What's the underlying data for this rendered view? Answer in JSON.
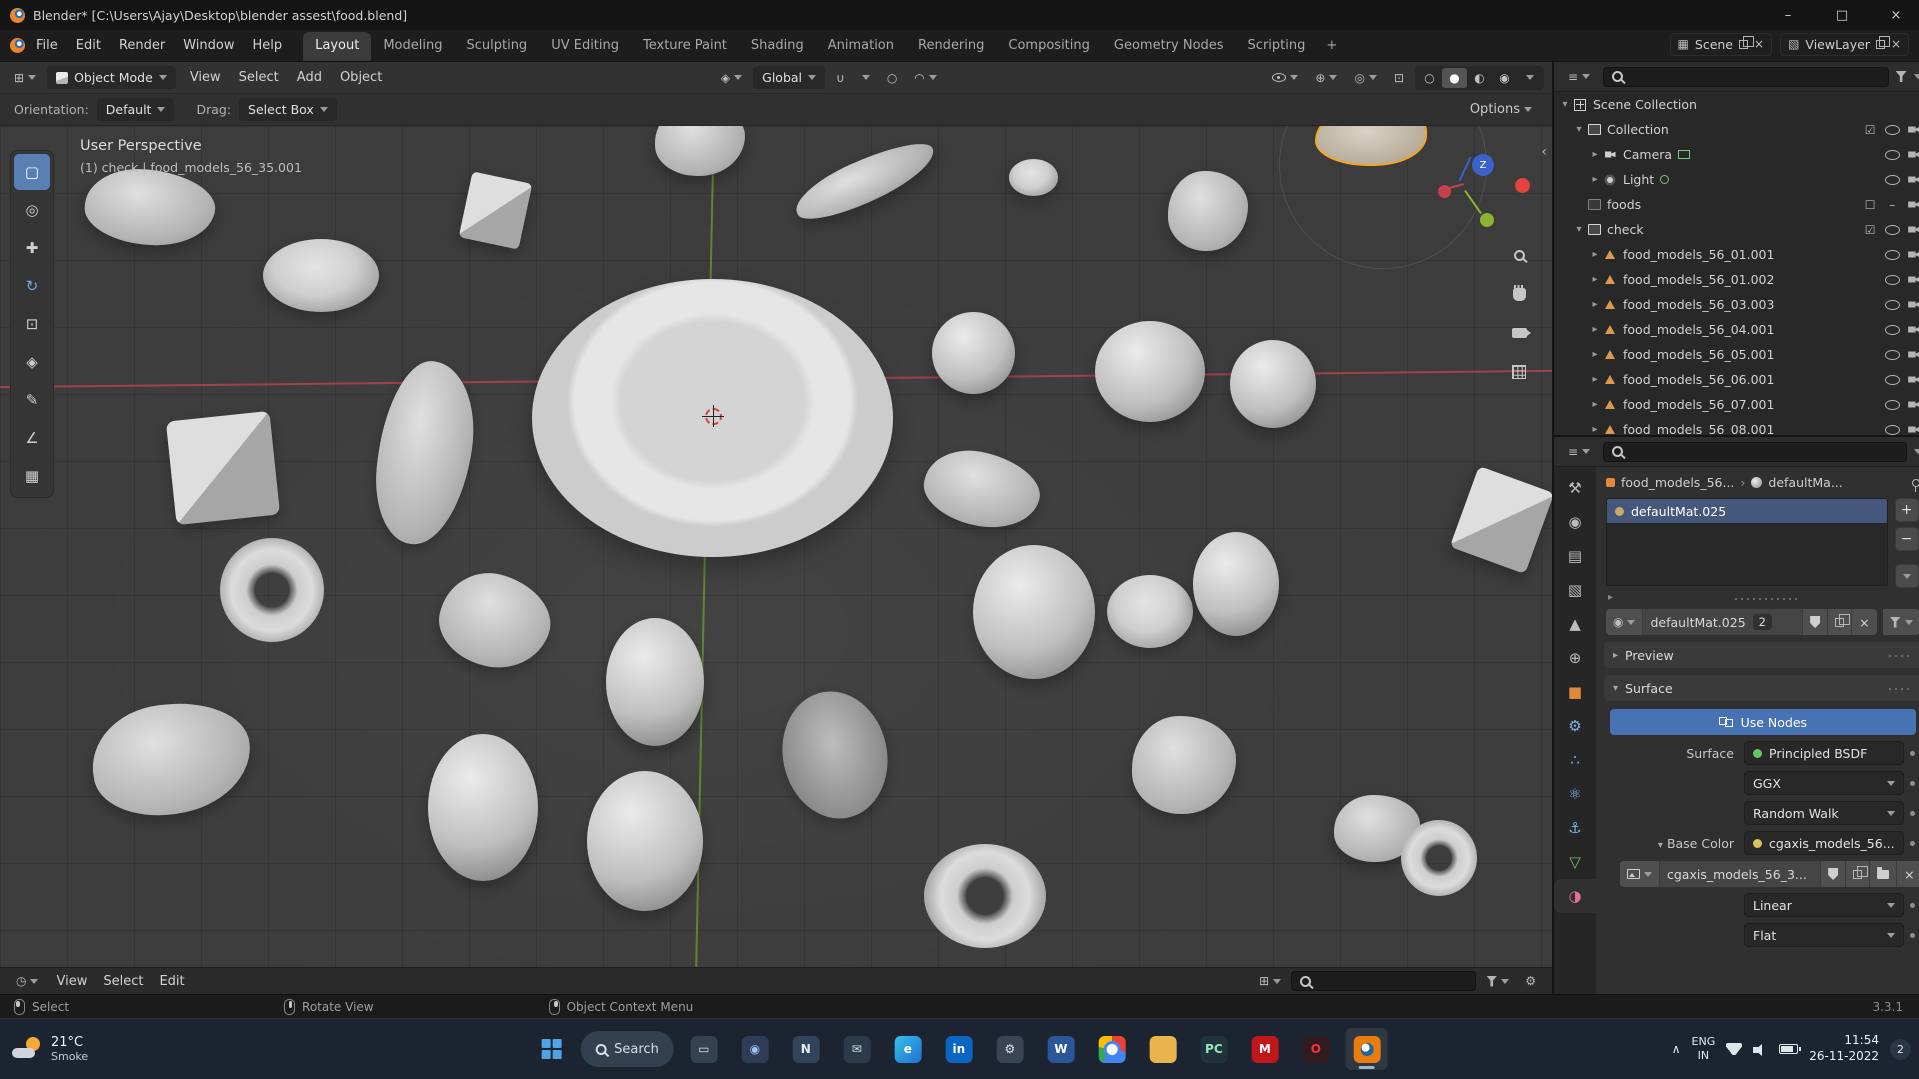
{
  "colors": {
    "accent": "#4772b3",
    "selection": "#f5a623",
    "mesh_icon": "#d99a4e"
  },
  "window": {
    "title": "Blender* [C:\\Users\\Ajay\\Desktop\\blender assest\\food.blend]",
    "minimize": "–",
    "maximize": "□",
    "close": "×"
  },
  "topbar": {
    "menus": [
      "File",
      "Edit",
      "Render",
      "Window",
      "Help"
    ],
    "workspaces": [
      {
        "label": "Layout",
        "active": true
      },
      {
        "label": "Modeling"
      },
      {
        "label": "Sculpting"
      },
      {
        "label": "UV Editing"
      },
      {
        "label": "Texture Paint"
      },
      {
        "label": "Shading"
      },
      {
        "label": "Animation"
      },
      {
        "label": "Rendering"
      },
      {
        "label": "Compositing"
      },
      {
        "label": "Geometry Nodes"
      },
      {
        "label": "Scripting"
      }
    ],
    "add_workspace": "+",
    "scene": {
      "label": "Scene"
    },
    "viewlayer": {
      "label": "ViewLayer"
    }
  },
  "viewport": {
    "header": {
      "mode": "Object Mode",
      "menus": [
        "View",
        "Select",
        "Add",
        "Object"
      ],
      "orientation": "Global",
      "options": "Options"
    },
    "subheader": {
      "orientation_label": "Orientation:",
      "orientation_value": "Default",
      "drag_label": "Drag:",
      "drag_value": "Select Box"
    },
    "overlay": {
      "line1": "User Perspective",
      "line2": "(1) check | food_models_56_35.001"
    },
    "gizmo": {
      "z": "Z"
    },
    "sidebar_toggle": "‹",
    "objects": [
      {
        "name": "plate",
        "kind": "plate",
        "style": "left:532px;top:153px;width:361px;height:278px"
      },
      {
        "name": "small-plate",
        "kind": "disc",
        "style": "left:263px;top:113px;width:116px;height:73px"
      },
      {
        "name": "butter-block",
        "kind": "cube",
        "style": "left:465px;top:51px;width:61px;height:67px;transform:rotate(12deg)"
      },
      {
        "name": "bread-loaf",
        "kind": "blob",
        "style": "left:85px;top:44px;width:130px;height:75px;transform:rotate(6deg)"
      },
      {
        "name": "pastry",
        "kind": "blob",
        "style": "left:655px;top:-22px;width:90px;height:72px"
      },
      {
        "name": "banana",
        "kind": "blob",
        "style": "left:790px;top:34px;width:150px;height:42px;transform:rotate(-24deg)"
      },
      {
        "name": "small-disc",
        "kind": "disc",
        "style": "left:1009px;top:33px;width:49px;height:37px"
      },
      {
        "name": "rock",
        "kind": "blob",
        "style": "left:1168px;top:45px;width:80px;height:80px"
      },
      {
        "name": "selected-sandwich",
        "kind": "selected",
        "style": "left:1315px;top:-18px;width:112px;height:58px"
      },
      {
        "name": "ball",
        "kind": "ball",
        "style": "left:932px;top:186px;width:83px;height:82px"
      },
      {
        "name": "ball",
        "kind": "ball",
        "style": "left:1095px;top:195px;width:110px;height:101px"
      },
      {
        "name": "ball",
        "kind": "ball",
        "style": "left:1230px;top:214px;width:86px;height:88px"
      },
      {
        "name": "cake-slice",
        "kind": "cube",
        "style": "left:171px;top:290px;width:104px;height:104px;transform:rotate(-6deg)"
      },
      {
        "name": "banana-bunch",
        "kind": "blob",
        "style": "left:379px;top:235px;width:92px;height:184px;transform:rotate(8deg)"
      },
      {
        "name": "shell-slices",
        "kind": "blob",
        "style": "left:924px;top:327px;width:116px;height:73px;transform:rotate(14deg)"
      },
      {
        "name": "cheese-wedge",
        "kind": "cube",
        "style": "left:1462px;top:351px;width:80px;height:86px;transform:rotate(20deg)"
      },
      {
        "name": "donut",
        "kind": "donut",
        "style": "left:220px;top:412px;width:104px;height:104px"
      },
      {
        "name": "croissant",
        "kind": "blob",
        "style": "left:440px;top:449px;width:110px;height:92px;transform:rotate(18deg)"
      },
      {
        "name": "apple-half",
        "kind": "ball",
        "style": "left:606px;top:492px;width:98px;height:128px"
      },
      {
        "name": "ball",
        "kind": "ball",
        "style": "left:973px;top:419px;width:122px;height:134px"
      },
      {
        "name": "cheese-wheel",
        "kind": "disc",
        "style": "left:1107px;top:449px;width:86px;height:73px"
      },
      {
        "name": "ball",
        "kind": "ball",
        "style": "left:1193px;top:406px;width:86px;height:104px"
      },
      {
        "name": "bread-slices",
        "kind": "blob",
        "style": "left:92px;top:578px;width:159px;height:110px;transform:rotate(-8deg)"
      },
      {
        "name": "striped-fruit",
        "kind": "ball",
        "style": "left:428px;top:608px;width:110px;height:147px"
      },
      {
        "name": "melon-half",
        "kind": "ball",
        "style": "left:587px;top:645px;width:116px;height:140px"
      },
      {
        "name": "cut-fruit",
        "kind": "disc-dark",
        "style": "left:783px;top:565px;width:104px;height:128px;transform:rotate(-12deg)"
      },
      {
        "name": "lettuce",
        "kind": "blob",
        "style": "left:1132px;top:590px;width:104px;height:98px"
      },
      {
        "name": "rock",
        "kind": "blob",
        "style": "left:1334px;top:669px;width:86px;height:67px"
      },
      {
        "name": "donut",
        "kind": "donut",
        "style": "left:924px;top:718px;width:122px;height:104px"
      },
      {
        "name": "donut",
        "kind": "donut",
        "style": "left:1401px;top:694px;width:76px;height:76px"
      }
    ]
  },
  "toolbar": {
    "tools": [
      {
        "name": "select-box",
        "glyph": "▢",
        "color": "#ffffff",
        "active": true
      },
      {
        "name": "cursor",
        "glyph": "◎",
        "color": "#cfcfcf"
      },
      {
        "name": "move",
        "glyph": "✚",
        "color": "#cfcfcf"
      },
      {
        "name": "rotate",
        "glyph": "↻",
        "color": "#74a8e0"
      },
      {
        "name": "scale",
        "glyph": "⊡",
        "color": "#cfcfcf"
      },
      {
        "name": "transform",
        "glyph": "◈",
        "color": "#cfcfcf"
      },
      {
        "name": "annotate",
        "glyph": "✎",
        "color": "#cfcfcf"
      },
      {
        "name": "measure",
        "glyph": "∠",
        "color": "#cfcfcf"
      },
      {
        "name": "add-cube",
        "glyph": "▦",
        "color": "#cfcfcf"
      }
    ]
  },
  "editor_bar": {
    "menus": [
      "View",
      "Select",
      "Edit"
    ]
  },
  "outliner": {
    "rows": [
      {
        "pad": "4px",
        "exp": "▾",
        "ic": "scene",
        "label": "Scene Collection",
        "controls": []
      },
      {
        "pad": "18px",
        "exp": "▾",
        "ic": "col",
        "label": "Collection",
        "controls": [
          {
            "kind": "check"
          },
          {
            "kind": "eye"
          },
          {
            "kind": "cam"
          }
        ]
      },
      {
        "pad": "34px",
        "exp": "▸",
        "ic": "cam",
        "label": "Camera",
        "badge": "screen",
        "controls": [
          {
            "kind": "eye"
          },
          {
            "kind": "cam"
          }
        ]
      },
      {
        "pad": "34px",
        "exp": "▸",
        "ic": "light",
        "label": "Light",
        "badge": "dot",
        "controls": [
          {
            "kind": "eye"
          },
          {
            "kind": "cam"
          }
        ]
      },
      {
        "pad": "18px",
        "exp": "",
        "ic": "col-dim",
        "label": "foods",
        "controls": [
          {
            "kind": "check-off"
          },
          {
            "kind": "dash"
          },
          {
            "kind": "cam"
          }
        ]
      },
      {
        "pad": "18px",
        "exp": "▾",
        "ic": "col",
        "label": "check",
        "controls": [
          {
            "kind": "check"
          },
          {
            "kind": "eye"
          },
          {
            "kind": "cam"
          }
        ]
      },
      {
        "pad": "34px",
        "exp": "▸",
        "ic": "mesh",
        "label": "food_models_56_01.001",
        "controls": [
          {
            "kind": "eye"
          },
          {
            "kind": "cam"
          }
        ]
      },
      {
        "pad": "34px",
        "exp": "▸",
        "ic": "mesh",
        "label": "food_models_56_01.002",
        "controls": [
          {
            "kind": "eye"
          },
          {
            "kind": "cam"
          }
        ]
      },
      {
        "pad": "34px",
        "exp": "▸",
        "ic": "mesh",
        "label": "food_models_56_03.003",
        "controls": [
          {
            "kind": "eye"
          },
          {
            "kind": "cam"
          }
        ]
      },
      {
        "pad": "34px",
        "exp": "▸",
        "ic": "mesh",
        "label": "food_models_56_04.001",
        "controls": [
          {
            "kind": "eye"
          },
          {
            "kind": "cam"
          }
        ]
      },
      {
        "pad": "34px",
        "exp": "▸",
        "ic": "mesh",
        "label": "food_models_56_05.001",
        "controls": [
          {
            "kind": "eye"
          },
          {
            "kind": "cam"
          }
        ]
      },
      {
        "pad": "34px",
        "exp": "▸",
        "ic": "mesh",
        "label": "food_models_56_06.001",
        "controls": [
          {
            "kind": "eye"
          },
          {
            "kind": "cam"
          }
        ]
      },
      {
        "pad": "34px",
        "exp": "▸",
        "ic": "mesh",
        "label": "food_models_56_07.001",
        "controls": [
          {
            "kind": "eye"
          },
          {
            "kind": "cam"
          }
        ]
      },
      {
        "pad": "34px",
        "exp": "▸",
        "ic": "mesh",
        "label": "food_models_56_08.001",
        "controls": [
          {
            "kind": "eye"
          },
          {
            "kind": "cam"
          }
        ]
      }
    ]
  },
  "properties": {
    "tabs": [
      {
        "name": "tool",
        "glyph": "⚒",
        "color": "#bdbdbd"
      },
      {
        "name": "render",
        "glyph": "◉",
        "color": "#bdbdbd"
      },
      {
        "name": "output",
        "glyph": "▤",
        "color": "#bdbdbd"
      },
      {
        "name": "view-layer",
        "glyph": "▧",
        "color": "#bdbdbd"
      },
      {
        "name": "scene",
        "glyph": "▲",
        "color": "#bdbdbd"
      },
      {
        "name": "world",
        "glyph": "⊕",
        "color": "#bdbdbd"
      },
      {
        "name": "object",
        "glyph": "■",
        "color": "#e2873c"
      },
      {
        "name": "modifiers",
        "glyph": "⚙",
        "color": "#7fb2e5"
      },
      {
        "name": "particles",
        "glyph": "∴",
        "color": "#7fb2e5"
      },
      {
        "name": "physics",
        "glyph": "⚛",
        "color": "#7fb2e5"
      },
      {
        "name": "constraints",
        "glyph": "⚓",
        "color": "#7fb2e5"
      },
      {
        "name": "object-data",
        "glyph": "▽",
        "color": "#75c375"
      },
      {
        "name": "material",
        "glyph": "◑",
        "color": "#e0709a",
        "active": true
      }
    ],
    "breadcrumb": {
      "object": "food_models_56...",
      "separator": "›",
      "material": "defaultMa..."
    },
    "slot": {
      "name": "defaultMat.025"
    },
    "slot_add": "+",
    "slot_remove": "−",
    "slot_specials": "▸",
    "material": {
      "name": "defaultMat.025",
      "users": "2",
      "unlink": "×"
    },
    "sections": {
      "preview_exp": "▸",
      "preview": "Preview",
      "surface_exp": "▾",
      "surface": "Surface"
    },
    "use_nodes": "Use Nodes",
    "rows": {
      "surface_label": "Surface",
      "surface_value": "Principled BSDF",
      "distribution": "GGX",
      "subsurface": "Random Walk",
      "base_color_exp": "▾",
      "base_color_label": "Base Color",
      "base_color_value": "cgaxis_models_56...",
      "image_name": "cgaxis_models_56_3...",
      "image_unlink": "×",
      "interpolation": "Linear",
      "extension": "Flat"
    }
  },
  "status_bar": {
    "hints": [
      {
        "button": "left",
        "label": "Select"
      },
      {
        "button": "middle",
        "label": "Rotate View"
      },
      {
        "button": "right",
        "label": "Object Context Menu"
      }
    ],
    "version": "3.3.1"
  },
  "taskbar": {
    "weather": {
      "temp": "21°C",
      "desc": "Smoke"
    },
    "search": "Search",
    "apps": [
      {
        "name": "file-explorer",
        "glyph": "▭",
        "bg": "#34414f",
        "fg": "#d8e2ec"
      },
      {
        "name": "camera-app",
        "glyph": "◉",
        "bg": "#2e3d55",
        "fg": "#9cc4f5"
      },
      {
        "name": "notepad-app",
        "glyph": "N",
        "bg": "#33435a",
        "fg": "#e8eef5"
      },
      {
        "name": "mail-app",
        "glyph": "✉",
        "bg": "#2c3a4a",
        "fg": "#cfe0f2"
      },
      {
        "name": "edge-browser",
        "glyph": "e",
        "bg": "linear-gradient(135deg,#35c1e8,#1f6fd0)",
        "fg": "#ffffff"
      },
      {
        "name": "linkedin-app",
        "glyph": "in",
        "bg": "#0a66c2",
        "fg": "#ffffff"
      },
      {
        "name": "settings-app",
        "glyph": "⚙",
        "bg": "#3a4553",
        "fg": "#dde4ec"
      },
      {
        "name": "word-app",
        "glyph": "W",
        "bg": "#2b579a",
        "fg": "#ffffff"
      },
      {
        "name": "chrome-browser",
        "glyph": "",
        "bg": "conic-gradient(#ea4335 0deg 100deg,#4285f4 100deg 220deg,#34a853 220deg 280deg,#fbbc05 280deg 360deg)",
        "fg": "#ffffff"
      },
      {
        "name": "file-folder",
        "glyph": "",
        "bg": "#e9b44c",
        "fg": "#f7debc"
      },
      {
        "name": "pycharm-app",
        "glyph": "PC",
        "bg": "#21323b",
        "fg": "#8de8c2"
      },
      {
        "name": "mcafee-app",
        "glyph": "M",
        "bg": "#c01818",
        "fg": "#ffffff"
      },
      {
        "name": "opera-browser",
        "glyph": "O",
        "bg": "#311b1f",
        "fg": "#ff2d3e"
      },
      {
        "name": "blender-app",
        "glyph": "",
        "bg": "#e87d0d",
        "fg": "#ffffff",
        "active": true
      }
    ],
    "tray": {
      "chevron": "∧",
      "lang1": "ENG",
      "lang2": "IN",
      "time": "11:54",
      "date": "26-11-2022",
      "badge": "2"
    }
  }
}
